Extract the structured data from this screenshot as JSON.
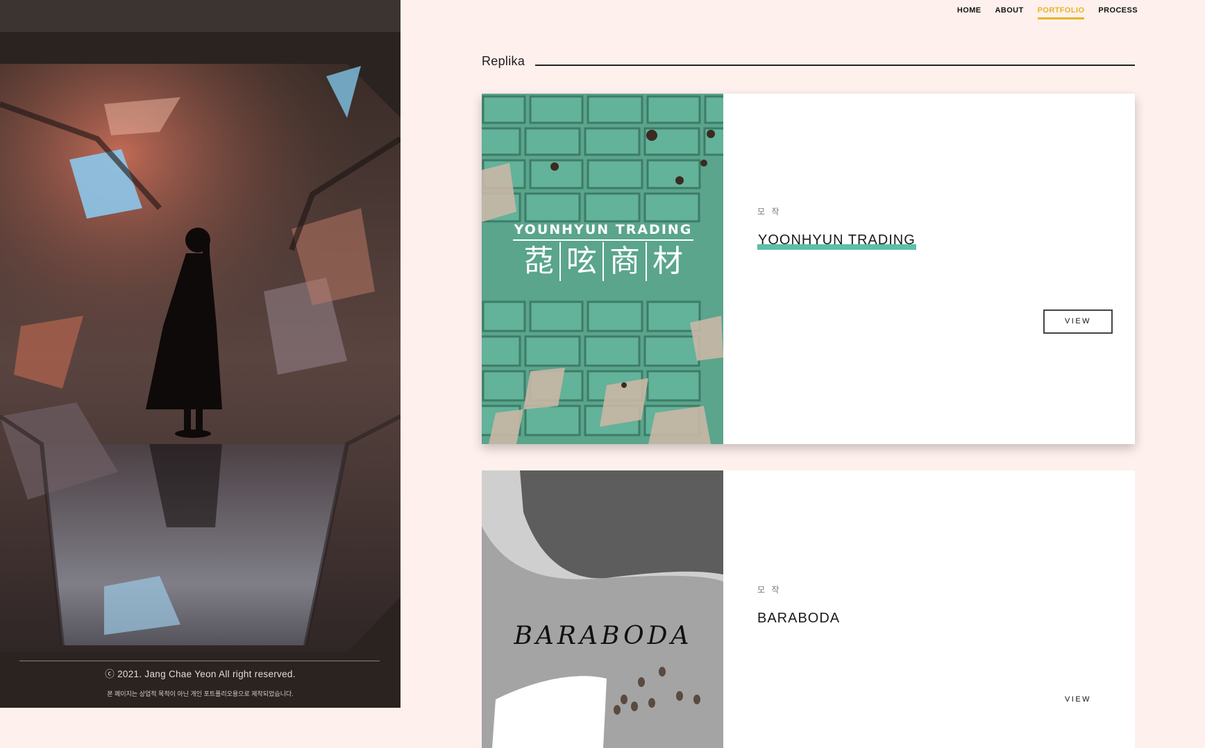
{
  "nav": {
    "items": [
      {
        "label": "HOME",
        "active": false
      },
      {
        "label": "ABOUT",
        "active": false
      },
      {
        "label": "PORTFOLIO",
        "active": true
      },
      {
        "label": "PROCESS",
        "active": false
      }
    ],
    "active_color": "#e9b521"
  },
  "section": {
    "title": "Replika"
  },
  "cards": [
    {
      "category": "모 작",
      "title": "YOONHYUN TRADING",
      "view_label": "VIEW",
      "thumb": {
        "brand_en": "YOUNHYUN TRADING",
        "brand_cjk": [
          "莻",
          "呟",
          "商",
          "材"
        ],
        "accent_color": "#5cbfa9"
      }
    },
    {
      "category": "모 작",
      "title": "BARABODA",
      "view_label": "VIEW",
      "thumb": {
        "brand": "BARABODA"
      }
    }
  ],
  "footer": {
    "copyright": "ⓒ 2021. Jang Chae Yeon All right reserved.",
    "note": "본 페이지는 상업적 목적이 아닌 개인 포트폴리오용으로 제작되었습니다."
  }
}
